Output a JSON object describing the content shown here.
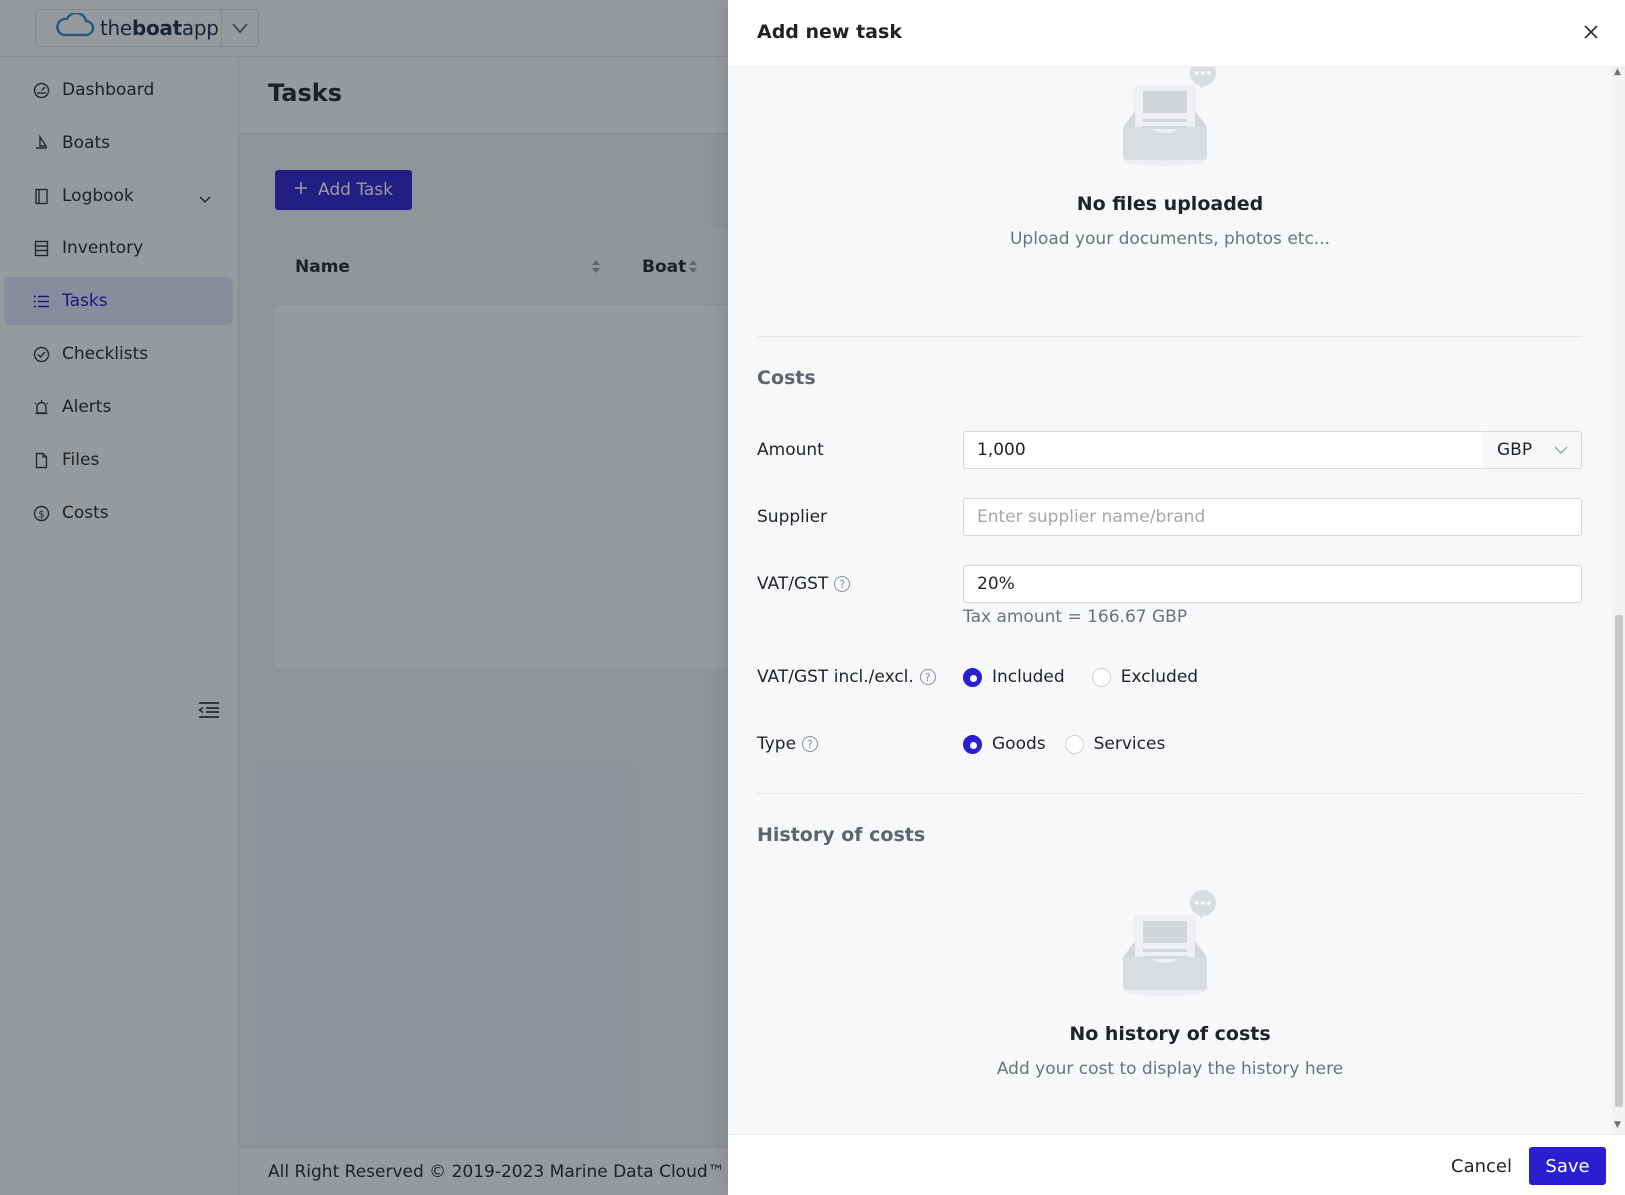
{
  "app": {
    "brand_light": "the",
    "brand_bold": "boat",
    "brand_tail": "app",
    "accent": "#2a1fd0"
  },
  "sidebar": {
    "items": [
      {
        "label": "Dashboard",
        "icon": "dashboard-icon"
      },
      {
        "label": "Boats",
        "icon": "boat-icon"
      },
      {
        "label": "Logbook",
        "icon": "logbook-icon"
      },
      {
        "label": "Inventory",
        "icon": "inventory-icon"
      },
      {
        "label": "Tasks",
        "icon": "tasks-icon",
        "active": true
      },
      {
        "label": "Checklists",
        "icon": "checklist-icon"
      },
      {
        "label": "Alerts",
        "icon": "alert-icon"
      },
      {
        "label": "Files",
        "icon": "file-icon"
      },
      {
        "label": "Costs",
        "icon": "costs-icon"
      }
    ]
  },
  "page": {
    "title": "Tasks",
    "add_button": "Add Task",
    "columns": [
      "Name",
      "Boat"
    ],
    "footer": "All Right Reserved © 2019-2023 Marine Data Cloud™"
  },
  "drawer": {
    "title": "Add new task",
    "files_empty": {
      "title": "No files uploaded",
      "subtitle": "Upload your documents, photos etc..."
    },
    "costs": {
      "section_title": "Costs",
      "amount_label": "Amount",
      "amount_value": "1,000",
      "currency": "GBP",
      "supplier_label": "Supplier",
      "supplier_placeholder": "Enter supplier name/brand",
      "vat_label": "VAT/GST",
      "vat_value": "20%",
      "tax_hint": "Tax amount = 166.67 GBP",
      "vat_incl_label": "VAT/GST incl./excl.",
      "vat_options": [
        "Included",
        "Excluded"
      ],
      "vat_selected": "Included",
      "type_label": "Type",
      "type_options": [
        "Goods",
        "Services"
      ],
      "type_selected": "Goods"
    },
    "history": {
      "section_title": "History of costs",
      "empty_title": "No history of costs",
      "empty_subtitle": "Add your cost to display the history here"
    },
    "cancel_label": "Cancel",
    "save_label": "Save"
  }
}
